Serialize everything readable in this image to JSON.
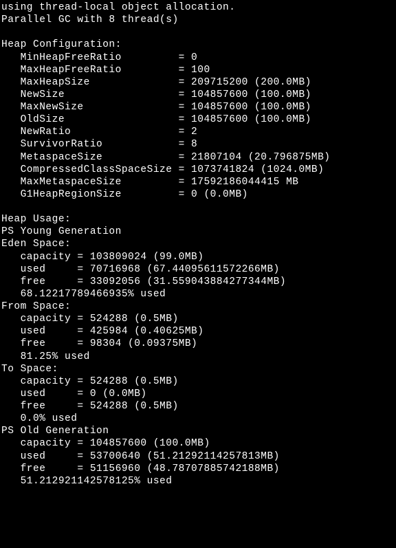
{
  "header_lines": [
    "using thread-local object allocation.",
    "Parallel GC with 8 thread(s)"
  ],
  "heap_config_title": "Heap Configuration:",
  "heap_config": [
    {
      "name": "MinHeapFreeRatio",
      "value": "0"
    },
    {
      "name": "MaxHeapFreeRatio",
      "value": "100"
    },
    {
      "name": "MaxHeapSize",
      "value": "209715200 (200.0MB)"
    },
    {
      "name": "NewSize",
      "value": "104857600 (100.0MB)"
    },
    {
      "name": "MaxNewSize",
      "value": "104857600 (100.0MB)"
    },
    {
      "name": "OldSize",
      "value": "104857600 (100.0MB)"
    },
    {
      "name": "NewRatio",
      "value": "2"
    },
    {
      "name": "SurvivorRatio",
      "value": "8"
    },
    {
      "name": "MetaspaceSize",
      "value": "21807104 (20.796875MB)"
    },
    {
      "name": "CompressedClassSpaceSize",
      "value": "1073741824 (1024.0MB)"
    },
    {
      "name": "MaxMetaspaceSize",
      "value": "17592186044415 MB"
    },
    {
      "name": "G1HeapRegionSize",
      "value": "0 (0.0MB)"
    }
  ],
  "heap_config_name_width": 24,
  "heap_usage_title": "Heap Usage:",
  "generations": [
    {
      "title": "PS Young Generation",
      "subspaces": [
        {
          "name": "Eden Space:",
          "rows": [
            {
              "label": "capacity",
              "value": "103809024 (99.0MB)"
            },
            {
              "label": "used",
              "value": "70716968 (67.44095611572266MB)"
            },
            {
              "label": "free",
              "value": "33092056 (31.559043884277344MB)"
            }
          ],
          "pct": "68.12217789466935% used"
        },
        {
          "name": "From Space:",
          "rows": [
            {
              "label": "capacity",
              "value": "524288 (0.5MB)"
            },
            {
              "label": "used",
              "value": "425984 (0.40625MB)"
            },
            {
              "label": "free",
              "value": "98304 (0.09375MB)"
            }
          ],
          "pct": "81.25% used"
        },
        {
          "name": "To Space:",
          "rows": [
            {
              "label": "capacity",
              "value": "524288 (0.5MB)"
            },
            {
              "label": "used",
              "value": "0 (0.0MB)"
            },
            {
              "label": "free",
              "value": "524288 (0.5MB)"
            }
          ],
          "pct": "0.0% used"
        }
      ]
    },
    {
      "title": "PS Old Generation",
      "subspaces": [
        {
          "name": "",
          "rows": [
            {
              "label": "capacity",
              "value": "104857600 (100.0MB)"
            },
            {
              "label": "used",
              "value": "53700640 (51.21292114257813MB)"
            },
            {
              "label": "free",
              "value": "51156960 (48.78707885742188MB)"
            }
          ],
          "pct": "51.212921142578125% used"
        }
      ]
    }
  ],
  "usage_label_width": 8,
  "indent": "   "
}
